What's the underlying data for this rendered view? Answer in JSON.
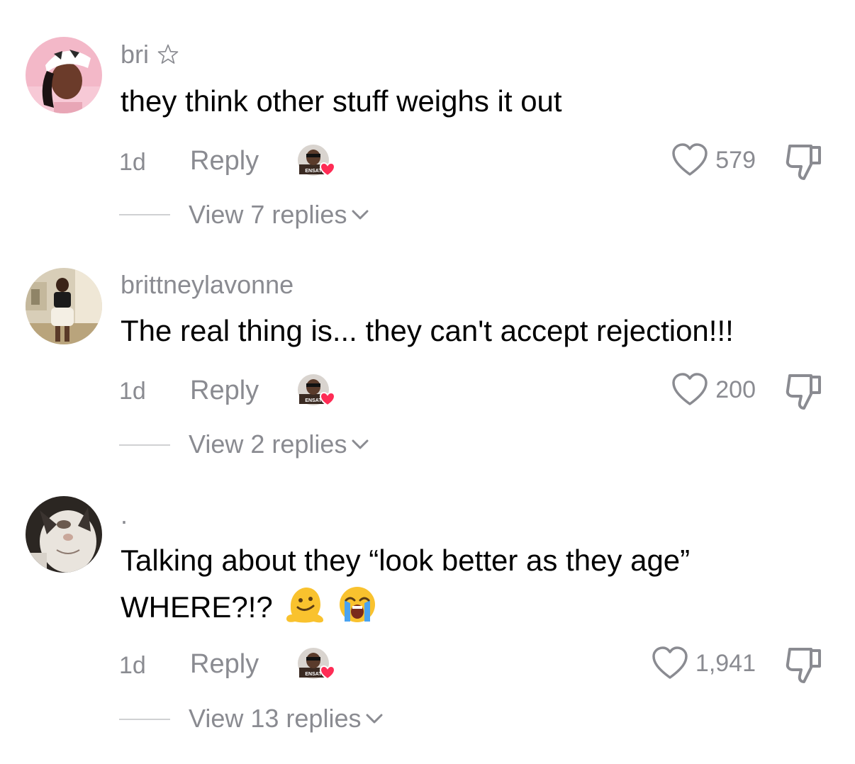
{
  "comments": [
    {
      "username": "bri",
      "badge_icon": "star-outline-icon",
      "text": "they think other stuff weighs it out",
      "time": "1d",
      "reply_label": "Reply",
      "creator_liked": true,
      "likes": "579",
      "view_replies": "View 7 replies"
    },
    {
      "username": "brittneylavonne",
      "text": "The real thing is... they can't accept rejection!!!",
      "time": "1d",
      "reply_label": "Reply",
      "creator_liked": true,
      "likes": "200",
      "view_replies": "View 2 replies"
    },
    {
      "username": ".",
      "text_line1": "Talking about they “look better as they age”",
      "text_line2": "WHERE?!?",
      "emojis": [
        "melting-face-emoji",
        "loudly-crying-face-emoji"
      ],
      "time": "1d",
      "reply_label": "Reply",
      "creator_liked": true,
      "likes": "1,941",
      "view_replies": "View 13 replies"
    }
  ],
  "creator_badge_text": "ENSAT",
  "colors": {
    "muted_text": "#8a8b91",
    "body_text": "#000000",
    "heart_red": "#fe2c55",
    "divider": "#d0d1d3"
  }
}
